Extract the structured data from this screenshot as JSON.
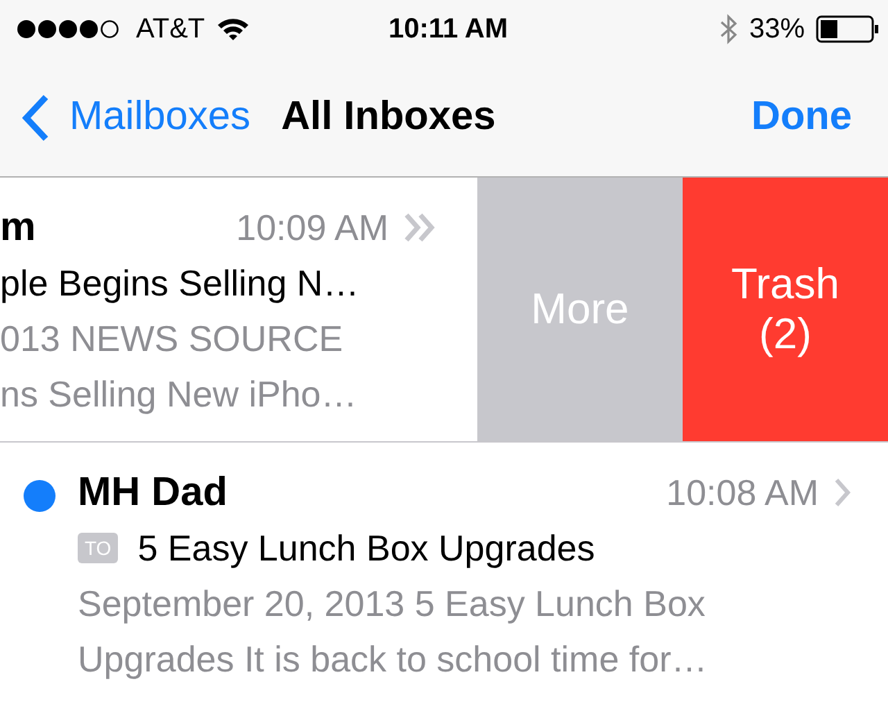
{
  "status_bar": {
    "carrier": "AT&T",
    "time": "10:11 AM",
    "battery": "33%"
  },
  "nav": {
    "back": "Mailboxes",
    "title": "All Inboxes",
    "action": "Done"
  },
  "messages": [
    {
      "kind": "swiped",
      "sender": "m",
      "time": "10:09 AM",
      "thread": true,
      "subject": "ple Begins Selling N…",
      "preview_lines": [
        "013 NEWS SOURCE",
        "ns Selling New iPho…"
      ],
      "actions": [
        {
          "kind": "more",
          "label": "More"
        },
        {
          "kind": "trash",
          "label": "Trash",
          "count": "(2)"
        }
      ]
    },
    {
      "kind": "normal",
      "sender": "MH Dad",
      "time": "10:08 AM",
      "thread": false,
      "unread": true,
      "to_badge": "TO",
      "subject": "5 Easy Lunch Box Upgrades",
      "preview_lines": [
        "September 20, 2013 5 Easy Lunch Box",
        "Upgrades It is back to school time for…"
      ]
    }
  ]
}
